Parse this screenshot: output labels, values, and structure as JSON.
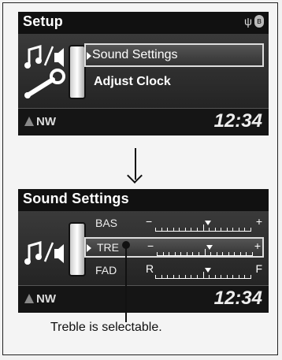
{
  "screen1": {
    "title": "Setup",
    "status_icons": [
      "usb-icon",
      "bluetooth-icon"
    ],
    "menu_items": [
      "Sound Settings",
      "Adjust Clock"
    ],
    "selected_index": 0,
    "heading": "NW",
    "clock": "12:34"
  },
  "screen2": {
    "title": "Sound Settings",
    "rows": [
      {
        "label": "BAS",
        "left_end": "−",
        "right_end": "+",
        "level": 0.55
      },
      {
        "label": "TRE",
        "left_end": "−",
        "right_end": "+",
        "level": 0.55
      },
      {
        "label": "FAD",
        "left_end": "R",
        "right_end": "F",
        "level": 0.55
      }
    ],
    "selected_row": 1,
    "heading": "NW",
    "clock": "12:34"
  },
  "caption": "Treble is selectable."
}
